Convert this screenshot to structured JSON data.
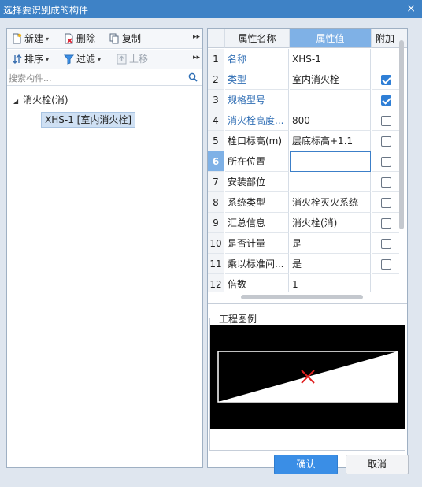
{
  "window": {
    "title": "选择要识别成的构件",
    "close_glyph": "×"
  },
  "toolbar": {
    "new_label": "新建",
    "delete_label": "删除",
    "copy_label": "复制",
    "sort_label": "排序",
    "filter_label": "过滤",
    "moveup_label": "上移",
    "dropdown_glyph": "▾",
    "more_glyph": "▸▸"
  },
  "search": {
    "placeholder": "搜索构件..."
  },
  "tree": {
    "root_label": "消火栓(消)",
    "expand_glyph": "◢",
    "child_label": "XHS-1 [室内消火栓]"
  },
  "grid": {
    "headers": {
      "name": "属性名称",
      "value": "属性值",
      "add": "附加"
    },
    "rows": [
      {
        "num": "1",
        "name": "名称",
        "value": "XHS-1",
        "checkbox": "none"
      },
      {
        "num": "2",
        "name": "类型",
        "value": "室内消火栓",
        "checkbox": "checked"
      },
      {
        "num": "3",
        "name": "规格型号",
        "value": "",
        "checkbox": "checked"
      },
      {
        "num": "4",
        "name": "消火栓高度...",
        "value": "800",
        "checkbox": "unchecked"
      },
      {
        "num": "5",
        "name": "栓口标高(m)",
        "value": "层底标高+1.1",
        "checkbox": "unchecked"
      },
      {
        "num": "6",
        "name": "所在位置",
        "value": "",
        "checkbox": "unchecked"
      },
      {
        "num": "7",
        "name": "安装部位",
        "value": "",
        "checkbox": "unchecked"
      },
      {
        "num": "8",
        "name": "系统类型",
        "value": "消火栓灭火系统",
        "checkbox": "unchecked"
      },
      {
        "num": "9",
        "name": "汇总信息",
        "value": "消火栓(消)",
        "checkbox": "unchecked"
      },
      {
        "num": "10",
        "name": "是否计量",
        "value": "是",
        "checkbox": "unchecked"
      },
      {
        "num": "11",
        "name": "乘以标准间...",
        "value": "是",
        "checkbox": "unchecked"
      },
      {
        "num": "12",
        "name": "倍数",
        "value": "1",
        "checkbox": "none"
      }
    ]
  },
  "legend": {
    "title": "工程图例"
  },
  "buttons": {
    "ok_label": "确认",
    "cancel_label": "取消"
  },
  "colors": {
    "accent": "#3a8ee6",
    "titlebar": "#3e82c6",
    "link": "#2e6db4",
    "marker": "#e02020"
  }
}
